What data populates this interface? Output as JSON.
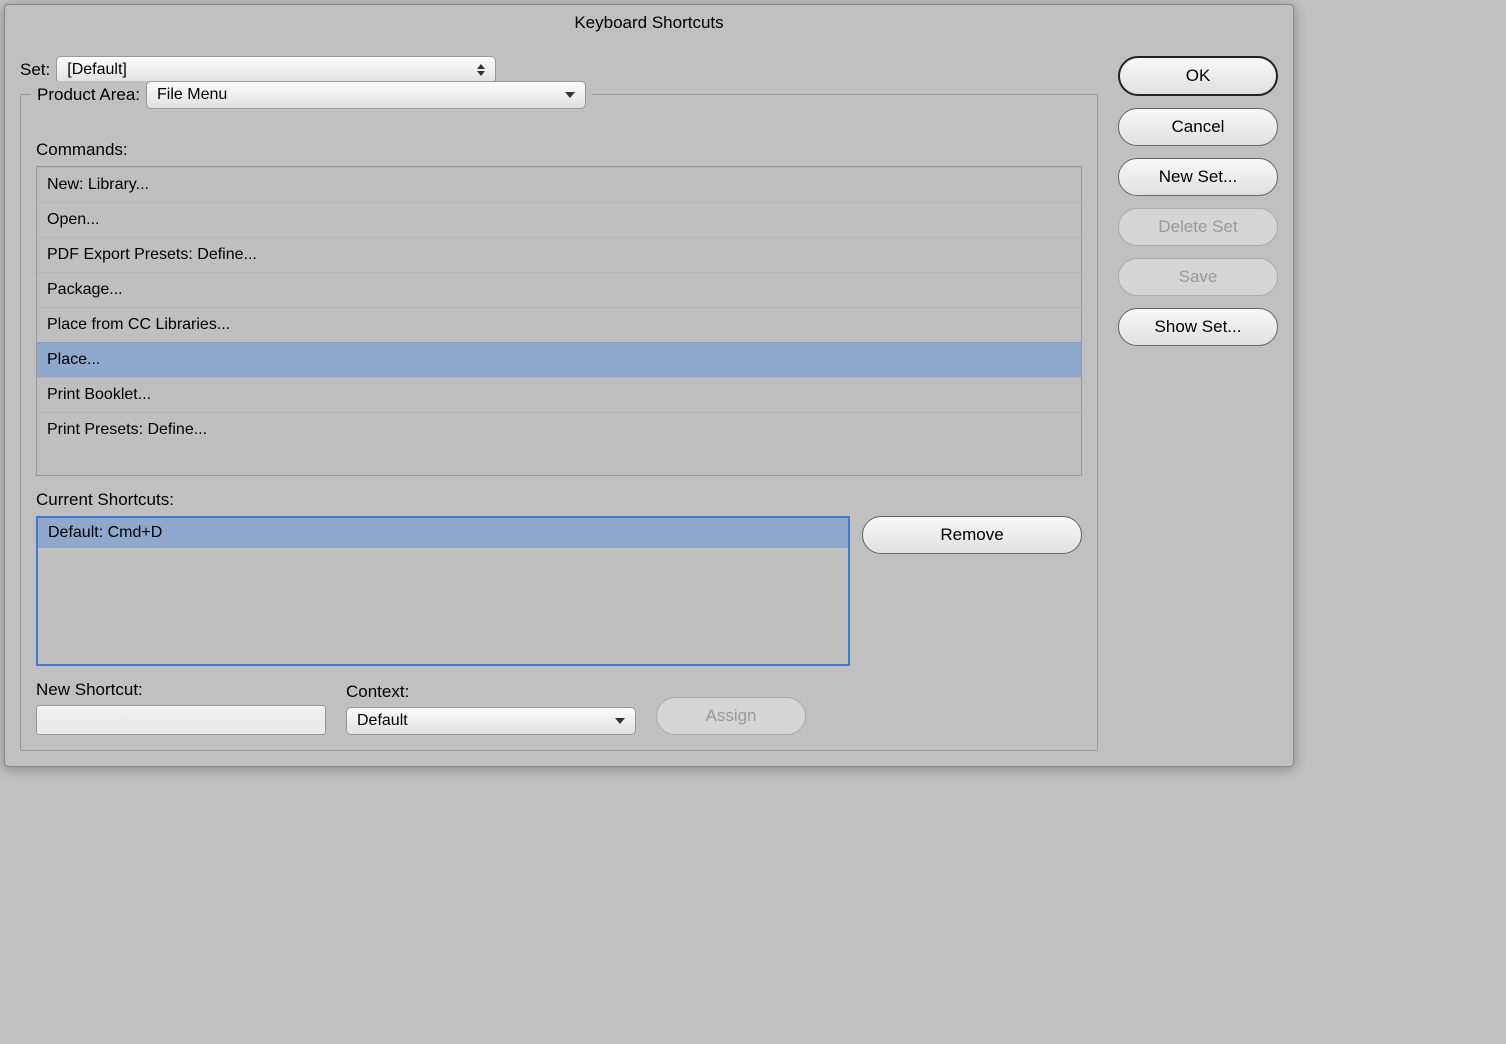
{
  "title": "Keyboard Shortcuts",
  "set_label": "Set:",
  "set_value": "[Default]",
  "product_area_label": "Product Area:",
  "product_area_value": "File Menu",
  "commands_label": "Commands:",
  "commands": [
    "New: Library...",
    "Open...",
    "PDF Export Presets: Define...",
    "Package...",
    "Place from CC Libraries...",
    "Place...",
    "Print Booklet...",
    "Print Presets: Define..."
  ],
  "selected_command_index": 5,
  "current_shortcuts_label": "Current Shortcuts:",
  "current_shortcuts": [
    "Default: Cmd+D"
  ],
  "new_shortcut_label": "New Shortcut:",
  "context_label": "Context:",
  "context_value": "Default",
  "buttons": {
    "ok": "OK",
    "cancel": "Cancel",
    "new_set": "New Set...",
    "delete_set": "Delete Set",
    "save": "Save",
    "show_set": "Show Set...",
    "remove": "Remove",
    "assign": "Assign"
  }
}
